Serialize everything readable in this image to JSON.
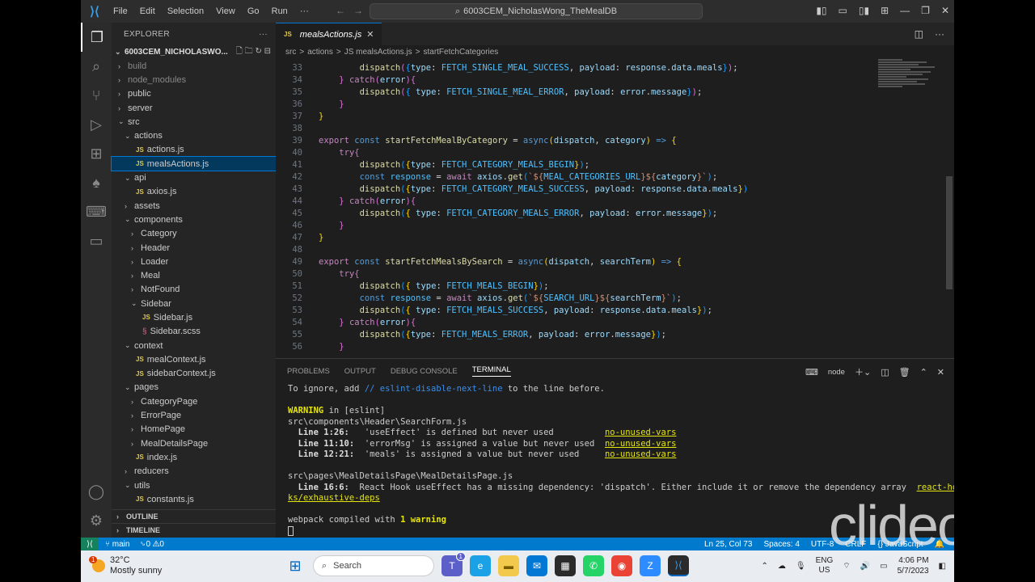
{
  "window": {
    "title": "6003CEM_NicholasWong_TheMealDB",
    "menu": [
      "File",
      "Edit",
      "Selection",
      "View",
      "Go",
      "Run",
      "···"
    ]
  },
  "sidebar": {
    "title": "EXPLORER",
    "project": "6003CEM_NICHOLASWO...",
    "tree": [
      {
        "label": "build",
        "depth": 1,
        "type": "folder",
        "dim": true
      },
      {
        "label": "node_modules",
        "depth": 1,
        "type": "folder",
        "dim": true
      },
      {
        "label": "public",
        "depth": 1,
        "type": "folder"
      },
      {
        "label": "server",
        "depth": 1,
        "type": "folder"
      },
      {
        "label": "src",
        "depth": 1,
        "type": "folder-open"
      },
      {
        "label": "actions",
        "depth": 2,
        "type": "folder-open"
      },
      {
        "label": "actions.js",
        "depth": 3,
        "type": "js"
      },
      {
        "label": "mealsActions.js",
        "depth": 3,
        "type": "js",
        "selected": true
      },
      {
        "label": "api",
        "depth": 2,
        "type": "folder-open"
      },
      {
        "label": "axios.js",
        "depth": 3,
        "type": "js"
      },
      {
        "label": "assets",
        "depth": 2,
        "type": "folder"
      },
      {
        "label": "components",
        "depth": 2,
        "type": "folder-open"
      },
      {
        "label": "Category",
        "depth": 3,
        "type": "folder"
      },
      {
        "label": "Header",
        "depth": 3,
        "type": "folder"
      },
      {
        "label": "Loader",
        "depth": 3,
        "type": "folder"
      },
      {
        "label": "Meal",
        "depth": 3,
        "type": "folder"
      },
      {
        "label": "NotFound",
        "depth": 3,
        "type": "folder"
      },
      {
        "label": "Sidebar",
        "depth": 3,
        "type": "folder-open"
      },
      {
        "label": "Sidebar.js",
        "depth": 4,
        "type": "js"
      },
      {
        "label": "Sidebar.scss",
        "depth": 4,
        "type": "scss"
      },
      {
        "label": "context",
        "depth": 2,
        "type": "folder-open"
      },
      {
        "label": "mealContext.js",
        "depth": 3,
        "type": "js"
      },
      {
        "label": "sidebarContext.js",
        "depth": 3,
        "type": "js"
      },
      {
        "label": "pages",
        "depth": 2,
        "type": "folder-open"
      },
      {
        "label": "CategoryPage",
        "depth": 3,
        "type": "folder"
      },
      {
        "label": "ErrorPage",
        "depth": 3,
        "type": "folder"
      },
      {
        "label": "HomePage",
        "depth": 3,
        "type": "folder"
      },
      {
        "label": "MealDetailsPage",
        "depth": 3,
        "type": "folder"
      },
      {
        "label": "index.js",
        "depth": 3,
        "type": "js"
      },
      {
        "label": "reducers",
        "depth": 2,
        "type": "folder"
      },
      {
        "label": "utils",
        "depth": 2,
        "type": "folder-open"
      },
      {
        "label": "constants.js",
        "depth": 3,
        "type": "js"
      }
    ],
    "outline": "OUTLINE",
    "timeline": "TIMELINE"
  },
  "editor": {
    "tab": "mealsActions.js",
    "breadcrumb": [
      "src",
      ">",
      "actions",
      ">",
      "JS mealsActions.js",
      ">",
      "startFetchCategories"
    ],
    "lines": [
      {
        "n": "33",
        "html": "        <span class='fn'>dispatch</span><span class='br2'>(</span><span class='br3'>{</span><span class='var'>type</span>: <span class='cst'>FETCH_SINGLE_MEAL_SUCCESS</span>, <span class='var'>payload</span>: <span class='var'>response</span>.<span class='var'>data</span>.<span class='var'>meals</span><span class='br3'>}</span><span class='br2'>)</span>;"
      },
      {
        "n": "34",
        "html": "    <span class='br2'>}</span> <span class='ctl'>catch</span><span class='br2'>(</span><span class='var'>error</span><span class='br2'>){</span>"
      },
      {
        "n": "35",
        "html": "        <span class='fn'>dispatch</span><span class='br2'>(</span><span class='br3'>{</span> <span class='var'>type</span>: <span class='cst'>FETCH_SINGLE_MEAL_ERROR</span>, <span class='var'>payload</span>: <span class='var'>error</span>.<span class='var'>message</span><span class='br3'>}</span><span class='br2'>)</span>;"
      },
      {
        "n": "36",
        "html": "    <span class='br2'>}</span>"
      },
      {
        "n": "37",
        "html": "<span class='br'>}</span>"
      },
      {
        "n": "38",
        "html": ""
      },
      {
        "n": "39",
        "html": "<span class='ctl'>export</span> <span class='kw'>const</span> <span class='fn'>startFetchMealByCategory</span> = <span class='kw'>async</span><span class='br'>(</span><span class='var'>dispatch</span>, <span class='var'>category</span><span class='br'>)</span> <span class='kw'>=&gt;</span> <span class='br'>{</span>"
      },
      {
        "n": "40",
        "html": "    <span class='ctl'>try</span><span class='br2'>{</span>"
      },
      {
        "n": "41",
        "html": "        <span class='fn'>dispatch</span><span class='br3'>(</span><span class='br'>{</span><span class='var'>type</span>: <span class='cst'>FETCH_CATEGORY_MEALS_BEGIN</span><span class='br'>}</span><span class='br3'>)</span>;"
      },
      {
        "n": "42",
        "html": "        <span class='kw'>const</span> <span class='cst'>response</span> = <span class='ctl'>await</span> <span class='var'>axios</span>.<span class='fn'>get</span><span class='br3'>(</span><span class='str'>`${</span><span class='cst'>MEAL_CATEGORIES_URL</span><span class='str'>}${</span><span class='var'>category</span><span class='str'>}`</span><span class='br3'>)</span>;"
      },
      {
        "n": "43",
        "html": "        <span class='fn'>dispatch</span><span class='br3'>(</span><span class='br'>{</span><span class='var'>type</span>: <span class='cst'>FETCH_CATEGORY_MEALS_SUCCESS</span>, <span class='var'>payload</span>: <span class='var'>response</span>.<span class='var'>data</span>.<span class='var'>meals</span><span class='br'>}</span><span class='br3'>)</span>"
      },
      {
        "n": "44",
        "html": "    <span class='br2'>}</span> <span class='ctl'>catch</span><span class='br2'>(</span><span class='var'>error</span><span class='br2'>){</span>"
      },
      {
        "n": "45",
        "html": "        <span class='fn'>dispatch</span><span class='br3'>(</span><span class='br'>{</span> <span class='var'>type</span>: <span class='cst'>FETCH_CATEGORY_MEALS_ERROR</span>, <span class='var'>payload</span>: <span class='var'>error</span>.<span class='var'>message</span><span class='br'>}</span><span class='br3'>)</span>;"
      },
      {
        "n": "46",
        "html": "    <span class='br2'>}</span>"
      },
      {
        "n": "47",
        "html": "<span class='br'>}</span>"
      },
      {
        "n": "48",
        "html": ""
      },
      {
        "n": "49",
        "html": "<span class='ctl'>export</span> <span class='kw'>const</span> <span class='fn'>startFetchMealsBySearch</span> = <span class='kw'>async</span><span class='br'>(</span><span class='var'>dispatch</span>, <span class='var'>searchTerm</span><span class='br'>)</span> <span class='kw'>=&gt;</span> <span class='br'>{</span>"
      },
      {
        "n": "50",
        "html": "    <span class='ctl'>try</span><span class='br2'>{</span>"
      },
      {
        "n": "51",
        "html": "        <span class='fn'>dispatch</span><span class='br3'>(</span><span class='br'>{</span> <span class='var'>type</span>: <span class='cst'>FETCH_MEALS_BEGIN</span><span class='br'>}</span><span class='br3'>)</span>;"
      },
      {
        "n": "52",
        "html": "        <span class='kw'>const</span> <span class='cst'>response</span> = <span class='ctl'>await</span> <span class='var'>axios</span>.<span class='fn'>get</span><span class='br3'>(</span><span class='str'>`${</span><span class='cst'>SEARCH_URL</span><span class='str'>}${</span><span class='var'>searchTerm</span><span class='str'>}`</span><span class='br3'>)</span>;"
      },
      {
        "n": "53",
        "html": "        <span class='fn'>dispatch</span><span class='br3'>(</span><span class='br'>{</span> <span class='var'>type</span>: <span class='cst'>FETCH_MEALS_SUCCESS</span>, <span class='var'>payload</span>: <span class='var'>response</span>.<span class='var'>data</span>.<span class='var'>meals</span><span class='br'>}</span><span class='br3'>)</span>;"
      },
      {
        "n": "54",
        "html": "    <span class='br2'>}</span> <span class='ctl'>catch</span><span class='br2'>(</span><span class='var'>error</span><span class='br2'>){</span>"
      },
      {
        "n": "55",
        "html": "        <span class='fn'>dispatch</span><span class='br3'>(</span><span class='br'>{</span><span class='var'>type</span>: <span class='cst'>FETCH_MEALS_ERROR</span>, <span class='var'>payload</span>: <span class='var'>error</span>.<span class='var'>message</span><span class='br'>}</span><span class='br3'>)</span>;"
      },
      {
        "n": "56",
        "html": "    <span class='br2'>}</span>"
      }
    ]
  },
  "panel": {
    "tabs": [
      "PROBLEMS",
      "OUTPUT",
      "DEBUG CONSOLE",
      "TERMINAL"
    ],
    "active": "TERMINAL",
    "shell": "node",
    "terminal": [
      "To ignore, add <span style='color:#3b8eea'>// eslint-disable-next-line</span> to the line before.",
      "",
      "<span class='yel'>WARNING</span> in [eslint]",
      "src\\components\\Header\\SearchForm.js",
      "  <span class='bold'>Line 1:26:</span>   'useEffect' is defined but never used          <span class='ul'>no-unused-vars</span>",
      "  <span class='bold'>Line 11:10:</span>  'errorMsg' is assigned a value but never used  <span class='ul'>no-unused-vars</span>",
      "  <span class='bold'>Line 12:21:</span>  'meals' is assigned a value but never used     <span class='ul'>no-unused-vars</span>",
      "",
      "src\\pages\\MealDetailsPage\\MealDetailsPage.js",
      "  <span class='bold'>Line 16:6:</span>  React Hook useEffect has a missing dependency: 'dispatch'. Either include it or remove the dependency array  <span class='ul'>react-hoo</span>",
      "<span class='ul'>ks/exhaustive-deps</span>",
      "",
      "webpack compiled with <span class='yel'>1 warning</span>"
    ]
  },
  "status": {
    "branch": "main",
    "errors": "␙0 ⚠0",
    "position": "Ln 25, Col 73",
    "spaces": "Spaces: 4",
    "encoding": "UTF-8",
    "eol": "CRLF",
    "language": "{} JavaScript"
  },
  "taskbar": {
    "temp": "32°C",
    "weather": "Mostly sunny",
    "search": "Search",
    "lang1": "ENG",
    "lang2": "US",
    "time": "4:06 PM",
    "date": "5/7/2023",
    "weather_badge": "1",
    "teams_badge": "1"
  },
  "watermark": "clideo.com"
}
